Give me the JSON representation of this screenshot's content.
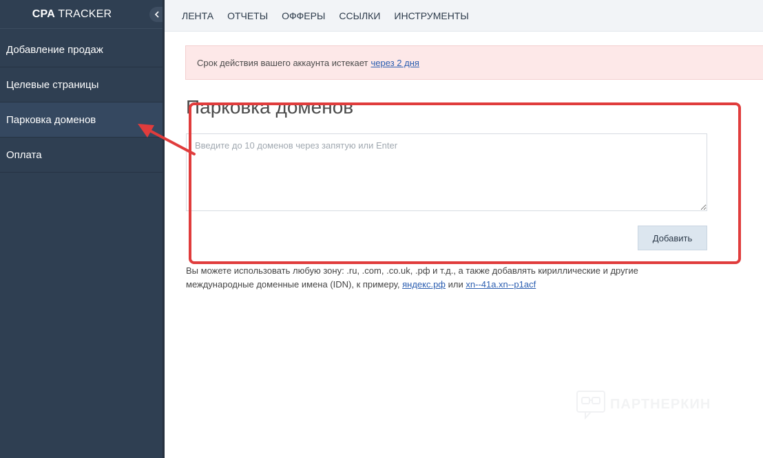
{
  "sidebar": {
    "brand_bold": "CPA",
    "brand_text": " TRACKER",
    "items": [
      {
        "label": "Добавление продаж"
      },
      {
        "label": "Целевые страницы"
      },
      {
        "label": "Парковка доменов"
      },
      {
        "label": "Оплата"
      }
    ]
  },
  "topnav": {
    "items": [
      {
        "label": "ЛЕНТА"
      },
      {
        "label": "ОТЧЕТЫ"
      },
      {
        "label": "ОФФЕРЫ"
      },
      {
        "label": "ССЫЛКИ"
      },
      {
        "label": "ИНСТРУМЕНТЫ"
      }
    ]
  },
  "alert": {
    "text": "Срок действия вашего аккаунта истекает",
    "link": "через 2 дня"
  },
  "main": {
    "title": "Парковка доменов",
    "input": {
      "placeholder": "Введите до 10 доменов через запятую или Enter",
      "value": ""
    },
    "add_button": "Добавить",
    "help": {
      "line1": "Вы можете использовать любую зону: .ru, .com, .co.uk, .рф и т.д., а также добавлять кириллические и другие",
      "line2_prefix": "международные доменные имена (IDN), к примеру, ",
      "example1": "яндекс.рф",
      "or": " или ",
      "example2": "xn--41a.xn--p1acf"
    }
  },
  "watermark": {
    "text": "ПАРТНЕРКИН"
  },
  "colors": {
    "sidebar_bg": "#2f3f52",
    "highlight": "#e03c3c",
    "alert_bg": "#fde8e8",
    "link": "#2a5db0"
  }
}
